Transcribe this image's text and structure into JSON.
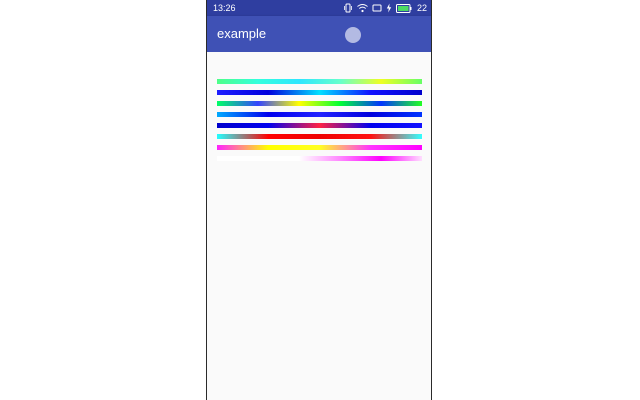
{
  "status_bar": {
    "time": "13:26",
    "battery_level": "22",
    "icons": [
      "vibrate-icon",
      "wifi-icon",
      "cast-icon",
      "charging-icon",
      "battery-icon"
    ]
  },
  "app_bar": {
    "title": "example",
    "color": "#3f51b5",
    "status_color": "#2f3ea0"
  },
  "gradient_bars": [
    {
      "name": "gradient-bar-1",
      "colors": [
        "#4dff88",
        "#33ffdd",
        "#2ee6ff",
        "#66ffcc",
        "#eeff22",
        "#66ff66"
      ]
    },
    {
      "name": "gradient-bar-2",
      "colors": [
        "#1e1eff",
        "#0000dd",
        "#00e0ff",
        "#1010ff",
        "#0000cc"
      ]
    },
    {
      "name": "gradient-bar-3",
      "colors": [
        "#00ff66",
        "#3344ff",
        "#ffff00",
        "#00ff33",
        "#0033ff",
        "#22ff22"
      ]
    },
    {
      "name": "gradient-bar-4",
      "colors": [
        "#00aaff",
        "#0000ee",
        "#2222ff",
        "#0000dd",
        "#0033ff"
      ]
    },
    {
      "name": "gradient-bar-5",
      "colors": [
        "#0000cc",
        "#0000ee",
        "#ff2244",
        "#0000ee",
        "#1111ff"
      ]
    },
    {
      "name": "gradient-bar-6",
      "colors": [
        "#22ffff",
        "#ff0000",
        "#ee0000",
        "#ff1111",
        "#33ffff"
      ]
    },
    {
      "name": "gradient-bar-7",
      "colors": [
        "#ff22ff",
        "#ffff00",
        "#ffff22",
        "#ff33ff",
        "#ff00ff"
      ]
    },
    {
      "name": "gradient-bar-8",
      "colors": [
        "#ffffff",
        "#ffffff",
        "#ffffff",
        "#ff88ff",
        "#ff00ff",
        "#ffddff"
      ]
    }
  ]
}
